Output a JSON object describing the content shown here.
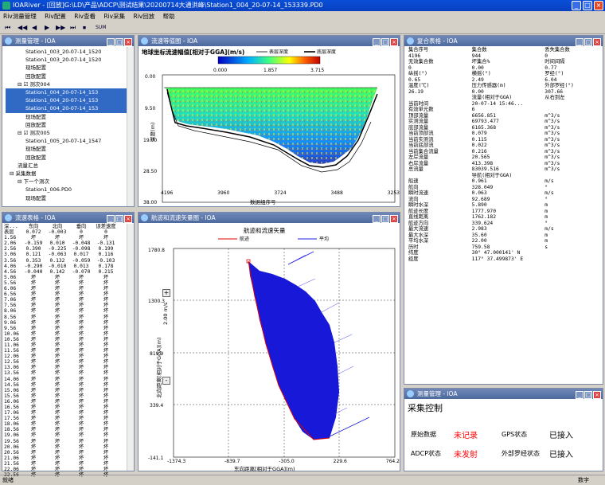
{
  "app": {
    "title": "IOARiver - [回放]G:\\LD\\产品\\ADCP\\测试结果\\20200714大通洪峰\\Station1_004_20-07-14_153339.PD0",
    "menu": [
      "Riv测量管理",
      "Riv配置",
      "Riv查看",
      "Riv采集",
      "Riv回放",
      "帮助"
    ],
    "toolbar": [
      "⏮",
      "◀◀",
      "◀",
      "▶",
      "▶▶",
      "⏭",
      "⏹",
      "SUM"
    ],
    "status_left": "就绪",
    "status_right": "数字"
  },
  "tree_pane": {
    "title": "测量管理 - IOA",
    "items": [
      {
        "text": "Station1_003_20-07-14_1520",
        "indent": 5
      },
      {
        "text": "Station1_003_20-07-14_1520",
        "indent": 5
      },
      {
        "text": "现场配置",
        "indent": 5
      },
      {
        "text": "回放配置",
        "indent": 5
      },
      {
        "text": "⊟ ☑ 测次004",
        "indent": 3
      },
      {
        "text": "Station1_004_20-07-14_153",
        "indent": 5,
        "selected": true
      },
      {
        "text": "Station1_004_20-07-14_153",
        "indent": 5,
        "selected": true
      },
      {
        "text": "Station1_004_20-07-14_153",
        "indent": 5,
        "selected": true
      },
      {
        "text": "现场配置",
        "indent": 5
      },
      {
        "text": "回放配置",
        "indent": 5
      },
      {
        "text": "⊟ ☑ 测次005",
        "indent": 3
      },
      {
        "text": "Station1_005_20-07-14_1547",
        "indent": 5
      },
      {
        "text": "现场配置",
        "indent": 5
      },
      {
        "text": "回放配置",
        "indent": 5
      },
      {
        "text": "流量汇总",
        "indent": 3
      },
      {
        "text": "⊟ 采集数据",
        "indent": 1
      },
      {
        "text": "⊟ 下一个测次",
        "indent": 3
      },
      {
        "text": "Station1_006.PD0",
        "indent": 5
      },
      {
        "text": "现场配置",
        "indent": 5
      }
    ]
  },
  "velocity_table": {
    "title": "流速表格 - IOA",
    "headers": [
      "深...",
      "东向",
      "北向",
      "垂向",
      "误差速度"
    ],
    "rows": [
      [
        "表层",
        "0.072",
        "-0.003",
        "0",
        "0"
      ],
      [
        "1.56",
        "坏",
        "坏",
        "坏",
        "坏"
      ],
      [
        "2.06",
        "-0.159",
        "0.010",
        "-0.048",
        "-0.131"
      ],
      [
        "2.56",
        "0.390",
        "-0.225",
        "-0.098",
        "0.199"
      ],
      [
        "3.06",
        "0.121",
        "-0.063",
        "0.017",
        "0.116"
      ],
      [
        "3.56",
        "0.353",
        "0.132",
        "-0.059",
        "-0.103"
      ],
      [
        "4.06",
        "-0.290",
        "-0.010",
        "0.013",
        "0.178"
      ],
      [
        "4.56",
        "-0.040",
        "0.142",
        "-0.070",
        "0.215"
      ],
      [
        "5.06",
        "坏",
        "坏",
        "坏",
        "坏"
      ],
      [
        "5.56",
        "坏",
        "坏",
        "坏",
        "坏"
      ],
      [
        "6.06",
        "坏",
        "坏",
        "坏",
        "坏"
      ],
      [
        "6.56",
        "坏",
        "坏",
        "坏",
        "坏"
      ],
      [
        "7.06",
        "坏",
        "坏",
        "坏",
        "坏"
      ],
      [
        "7.56",
        "坏",
        "坏",
        "坏",
        "坏"
      ],
      [
        "8.06",
        "坏",
        "坏",
        "坏",
        "坏"
      ],
      [
        "8.56",
        "坏",
        "坏",
        "坏",
        "坏"
      ],
      [
        "9.06",
        "坏",
        "坏",
        "坏",
        "坏"
      ],
      [
        "9.56",
        "坏",
        "坏",
        "坏",
        "坏"
      ],
      [
        "10.06",
        "坏",
        "坏",
        "坏",
        "坏"
      ],
      [
        "10.56",
        "坏",
        "坏",
        "坏",
        "坏"
      ],
      [
        "11.06",
        "坏",
        "坏",
        "坏",
        "坏"
      ],
      [
        "11.56",
        "坏",
        "坏",
        "坏",
        "坏"
      ],
      [
        "12.06",
        "坏",
        "坏",
        "坏",
        "坏"
      ],
      [
        "12.56",
        "坏",
        "坏",
        "坏",
        "坏"
      ],
      [
        "13.06",
        "坏",
        "坏",
        "坏",
        "坏"
      ],
      [
        "13.56",
        "坏",
        "坏",
        "坏",
        "坏"
      ],
      [
        "14.06",
        "坏",
        "坏",
        "坏",
        "坏"
      ],
      [
        "14.56",
        "坏",
        "坏",
        "坏",
        "坏"
      ],
      [
        "15.06",
        "坏",
        "坏",
        "坏",
        "坏"
      ],
      [
        "15.56",
        "坏",
        "坏",
        "坏",
        "坏"
      ],
      [
        "16.06",
        "坏",
        "坏",
        "坏",
        "坏"
      ],
      [
        "16.56",
        "坏",
        "坏",
        "坏",
        "坏"
      ],
      [
        "17.06",
        "坏",
        "坏",
        "坏",
        "坏"
      ],
      [
        "17.56",
        "坏",
        "坏",
        "坏",
        "坏"
      ],
      [
        "18.06",
        "坏",
        "坏",
        "坏",
        "坏"
      ],
      [
        "18.56",
        "坏",
        "坏",
        "坏",
        "坏"
      ],
      [
        "19.06",
        "坏",
        "坏",
        "坏",
        "坏"
      ],
      [
        "19.56",
        "坏",
        "坏",
        "坏",
        "坏"
      ],
      [
        "20.06",
        "坏",
        "坏",
        "坏",
        "坏"
      ],
      [
        "20.56",
        "坏",
        "坏",
        "坏",
        "坏"
      ],
      [
        "21.06",
        "坏",
        "坏",
        "坏",
        "坏"
      ],
      [
        "21.56",
        "坏",
        "坏",
        "坏",
        "坏"
      ],
      [
        "22.06",
        "坏",
        "坏",
        "坏",
        "坏"
      ],
      [
        "22.56",
        "坏",
        "坏",
        "坏",
        "坏"
      ]
    ]
  },
  "contour_pane": {
    "title": "流速等值图 - IOA",
    "chart_title": "地球坐标流速幅值[相对于GGA](m/s)",
    "legend_surface": "表层深度",
    "legend_bottom": "底层深度",
    "colorbar_ticks": [
      "0.000",
      "1.857",
      "3.715"
    ],
    "y_ticks": [
      "0.00",
      "9.50",
      "19.00",
      "28.50",
      "38.00"
    ],
    "y_label": "深度(m)",
    "x_ticks": [
      "4196",
      "3960",
      "3724",
      "3488",
      "3253"
    ],
    "x_label": "数据组序号"
  },
  "track_pane": {
    "title": "航迹和流速矢量图 - IOA",
    "chart_title": "航迹和流速矢量",
    "legend_track": "航迹",
    "legend_mean": "平均",
    "y_ticks": [
      "1780.8",
      "1300.3",
      "819.9",
      "339.4",
      "-141.1"
    ],
    "x_ticks": [
      "-1374.3",
      "-839.7",
      "-305.0",
      "229.6",
      "764.2"
    ],
    "x_label": "东向距离[相对于GGA](m)",
    "y_label": "北向距离[相对于GGA](m)",
    "scale_label": "2.00 m/s",
    "zoom_plus": "+",
    "zoom_minus": "-"
  },
  "summary_pane": {
    "title": "复合表格 - IOA",
    "rows": [
      [
        "集合序号",
        "集合数",
        "丢失集合数"
      ],
      [
        "4196",
        "944",
        "0"
      ],
      [
        "无效集合数",
        "坏集合%",
        "时间间隔"
      ],
      [
        "0",
        "0.00",
        "0.77"
      ],
      [
        "纵摇(°)",
        "横摇(°)",
        "罗经(°)"
      ],
      [
        "0.65",
        "2.49",
        "6.04"
      ],
      [
        "温度(℃)",
        "压力传感器(m)",
        "外部罗经(°)"
      ],
      [
        "26.19",
        "0.00",
        "307.66"
      ],
      [
        "",
        "流量(相对于GGA)",
        "从右到左"
      ],
      [
        "当前时间",
        "20-07-14 15:46...",
        ""
      ],
      [
        "有效单元数",
        "6",
        ""
      ],
      [
        "顶部流量",
        "6656.851",
        "m^3/s"
      ],
      [
        "实测流量",
        "69793.477",
        "m^3/s"
      ],
      [
        "底部流量",
        "6165.368",
        "m^3/s"
      ],
      [
        "当前顶部流",
        "0.079",
        "m^3/s"
      ],
      [
        "当前实测流",
        "0.115",
        "m^3/s"
      ],
      [
        "当前底部流",
        "0.022",
        "m^3/s"
      ],
      [
        "当前集合流量",
        "0.216",
        "m^3/s"
      ],
      [
        "左岸流量",
        "20.565",
        "m^3/s"
      ],
      [
        "右岸流量",
        "413.398",
        "m^3/s"
      ],
      [
        "总流量",
        "83039.516",
        "m^3/s"
      ],
      [
        "",
        "导航(相对于GGA)",
        ""
      ],
      [
        "船速",
        "0.961",
        "m/s"
      ],
      [
        "航向",
        "328.049",
        "°"
      ],
      [
        "瞬时流速",
        "0.063",
        "m/s"
      ],
      [
        "流向",
        "92.689",
        "°"
      ],
      [
        "瞬时水深",
        "5.890",
        "m"
      ],
      [
        "航迹长度",
        "1777.970",
        "m"
      ],
      [
        "直线距离",
        "1762.182",
        "m"
      ],
      [
        "航迹方向",
        "339.624",
        "°"
      ],
      [
        "最大流速",
        "2.983",
        "m/s"
      ],
      [
        "最大水深",
        "35.60",
        "m"
      ],
      [
        "平均水深",
        "22.00",
        "m"
      ],
      [
        "历时",
        "759.58",
        "s"
      ],
      [
        "纬度",
        "30° 47.000141' N",
        ""
      ],
      [
        "经度",
        "117° 37.499873' E",
        ""
      ]
    ]
  },
  "control_pane": {
    "title": "测量管理 - IOA",
    "heading": "采集控制",
    "raw_label": "原始数据",
    "raw_value": "未记录",
    "gps_label": "GPS状态",
    "gps_value": "已接入",
    "adcp_label": "ADCP状态",
    "adcp_value": "未发射",
    "compass_label": "外部罗经状态",
    "compass_value": "已接入",
    "alert_color": "#ff0000"
  }
}
